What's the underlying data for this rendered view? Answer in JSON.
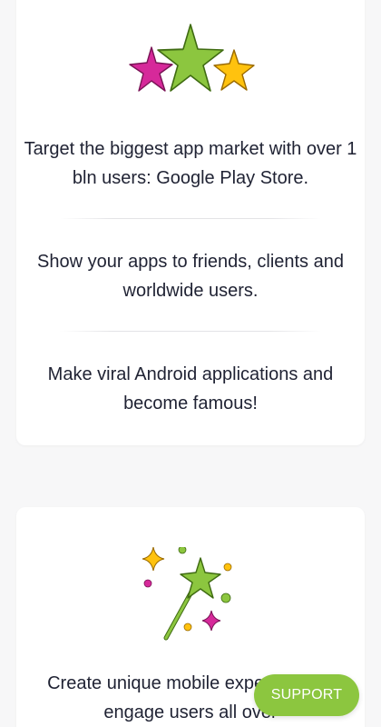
{
  "features_card_1": {
    "icon": "three-stars-icon",
    "items": [
      "Target the biggest app market with over 1 bln users: Google Play Store.",
      "Show your apps to friends, clients and worldwide users.",
      "Make viral Android applications and become famous!"
    ]
  },
  "features_card_2": {
    "icon": "magic-wand-icon",
    "items": [
      "Create unique mobile experience to engage users all over"
    ]
  },
  "support_button": {
    "label": "SUPPORT"
  },
  "colors": {
    "accent_green": "#8cc63f",
    "star_pink": "#d6299a",
    "star_yellow": "#ffc20e",
    "background": "#f7f7f8",
    "card": "#ffffff",
    "text": "#1f2233"
  }
}
